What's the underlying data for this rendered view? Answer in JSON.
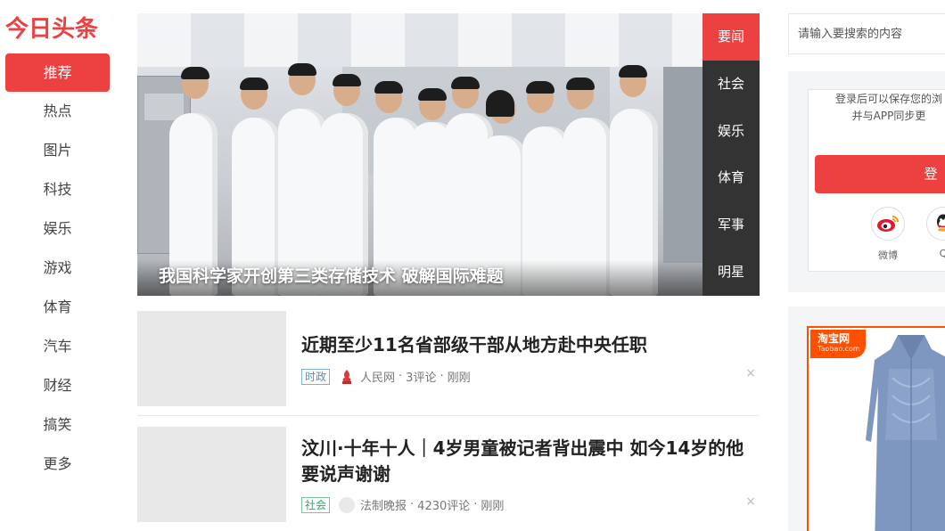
{
  "logo": "今日头条",
  "nav": {
    "items": [
      "推荐",
      "热点",
      "图片",
      "科技",
      "娱乐",
      "游戏",
      "体育",
      "汽车",
      "财经",
      "搞笑",
      "更多"
    ],
    "active_index": 0
  },
  "carousel": {
    "caption": "我国科学家开创第三类存储技术 破解国际难题",
    "tabs": [
      "要闻",
      "社会",
      "娱乐",
      "体育",
      "军事",
      "明星"
    ],
    "active_tab": 0
  },
  "articles": [
    {
      "title": "近期至少11名省部级干部从地方赴中央任职",
      "tag": "时政",
      "source": "人民网",
      "comments": "3评论",
      "time": "刚刚",
      "tag_color": "#4a90c8"
    },
    {
      "title": "汶川·十年十人｜4岁男童被记者背出震中 如今14岁的他要说声谢谢",
      "tag": "社会",
      "source": "法制晚报",
      "comments": "4230评论",
      "time": "刚刚",
      "tag_color": "#3aa06a"
    }
  ],
  "meta_sep": "·",
  "close_glyph": "×",
  "search": {
    "placeholder": "请输入要搜索的内容"
  },
  "login": {
    "line1": "登录后可以保存您的浏",
    "line2": "并与APP同步更",
    "button": "登",
    "socials": [
      {
        "label": "微博",
        "icon": "weibo-icon"
      },
      {
        "label": "Q",
        "icon": "qq-icon"
      }
    ]
  },
  "ad": {
    "brand_cn": "淘宝网",
    "brand_en": "Taobao.com"
  },
  "colors": {
    "accent": "#ed4040",
    "carousel_tabs_bg": "#333333",
    "taobao": "#ff5000"
  }
}
